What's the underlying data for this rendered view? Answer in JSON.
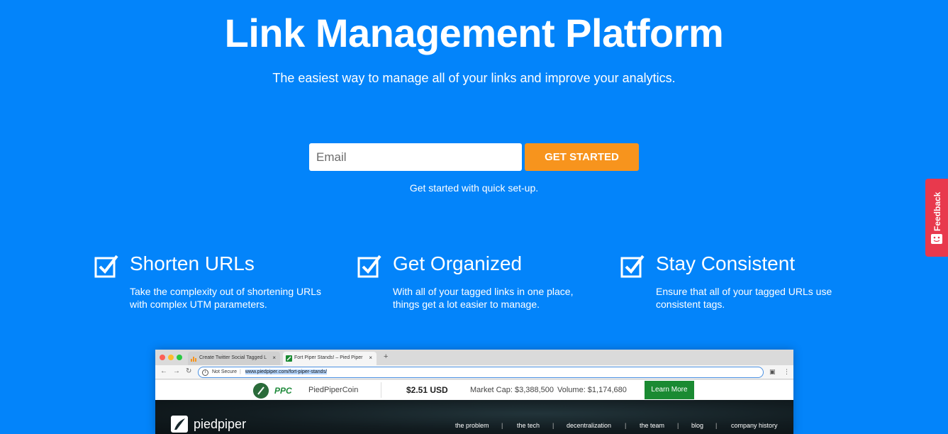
{
  "hero": {
    "title": "Link Management Platform",
    "subtitle": "The easiest way to manage all of your links and improve your analytics."
  },
  "signup": {
    "email_placeholder": "Email",
    "button_label": "GET STARTED",
    "note": "Get started with quick set-up."
  },
  "features": [
    {
      "title": "Shorten URLs",
      "description": "Take the complexity out of shortening URLs with complex UTM parameters."
    },
    {
      "title": "Get Organized",
      "description": "With all of your tagged links in one place, things get a lot easier to manage."
    },
    {
      "title": "Stay Consistent",
      "description": "Ensure that all of your tagged URLs use consistent tags."
    }
  ],
  "feedback": {
    "label": "Feedback"
  },
  "browser": {
    "tabs": [
      {
        "label": "Create Twitter Social Tagged L"
      },
      {
        "label": "Fort Piper Stands! – Pied Piper"
      }
    ],
    "new_tab": "+",
    "security_label": "Not Secure",
    "url": "www.piedpiper.com/fort-piper-stands/",
    "ticker": {
      "symbol": "PPC",
      "name": "PiedPiperCoin",
      "price": "$2.51 USD",
      "market_cap": "Market Cap: $3,388,500",
      "volume": "Volume: $1,174,680",
      "learn_more": "Learn More"
    },
    "site": {
      "brand": "piedpiper",
      "nav": [
        "the problem",
        "the tech",
        "decentralization",
        "the team",
        "blog",
        "company history"
      ]
    }
  },
  "colors": {
    "background": "#0384fa",
    "cta": "#f7941d",
    "feedback": "#e8394d",
    "ticker_button": "#1a8a32"
  }
}
